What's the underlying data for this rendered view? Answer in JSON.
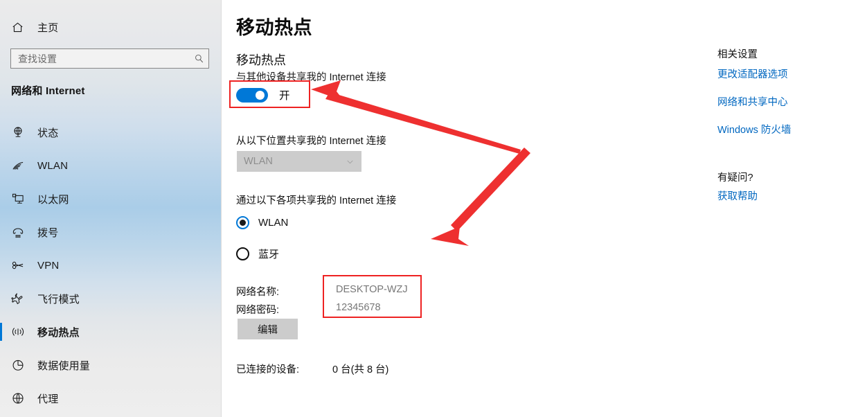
{
  "sidebar": {
    "home": {
      "label": "主页",
      "icon": "home-icon"
    },
    "search": {
      "placeholder": "查找设置",
      "value": "",
      "icon": "search-icon"
    },
    "category_heading": "网络和 Internet",
    "items": [
      {
        "label": "状态",
        "icon": "status-globe-icon",
        "selected": false
      },
      {
        "label": "WLAN",
        "icon": "wifi-icon",
        "selected": false
      },
      {
        "label": "以太网",
        "icon": "ethernet-icon",
        "selected": false
      },
      {
        "label": "拨号",
        "icon": "dialup-phone-icon",
        "selected": false
      },
      {
        "label": "VPN",
        "icon": "vpn-key-icon",
        "selected": false
      },
      {
        "label": "飞行模式",
        "icon": "airplane-icon",
        "selected": false
      },
      {
        "label": "移动热点",
        "icon": "hotspot-signal-icon",
        "selected": true
      },
      {
        "label": "数据使用量",
        "icon": "pie-chart-icon",
        "selected": false
      },
      {
        "label": "代理",
        "icon": "globe-icon",
        "selected": false
      }
    ]
  },
  "main": {
    "page_title": "移动热点",
    "section_title": "移动热点",
    "section_desc": "与其他设备共享我的 Internet 连接",
    "toggle": {
      "state_label": "开",
      "on": true
    },
    "share_from_label": "从以下位置共享我的 Internet 连接",
    "share_from_select": {
      "value": "WLAN",
      "disabled": true,
      "caret_icon": "chevron-down-icon"
    },
    "share_over_label": "通过以下各项共享我的 Internet 连接",
    "share_over_options": [
      {
        "label": "WLAN",
        "checked": true
      },
      {
        "label": "蓝牙",
        "checked": false
      }
    ],
    "network_name_label": "网络名称:",
    "network_name_value": "DESKTOP-WZJ",
    "network_password_label": "网络密码:",
    "network_password_value": "12345678",
    "edit_button_label": "编辑",
    "connected_devices_label": "已连接的设备:",
    "connected_devices_value": "0 台(共 8 台)"
  },
  "right_panel": {
    "related_heading": "相关设置",
    "related_links": [
      "更改适配器选项",
      "网络和共享中心",
      "Windows 防火墙"
    ],
    "question_heading": "有疑问?",
    "help_link": "获取帮助"
  },
  "annotations": {
    "highlight_color": "#ee2222",
    "boxes": [
      "toggle-highlight",
      "network-credentials-highlight"
    ],
    "arrows": [
      "arrow-to-toggle",
      "arrow-to-network-credentials"
    ]
  },
  "colors": {
    "accent": "#0078d7",
    "link": "#0067c0",
    "annotation": "#ee2222",
    "disabled_control": "#cccccc"
  }
}
